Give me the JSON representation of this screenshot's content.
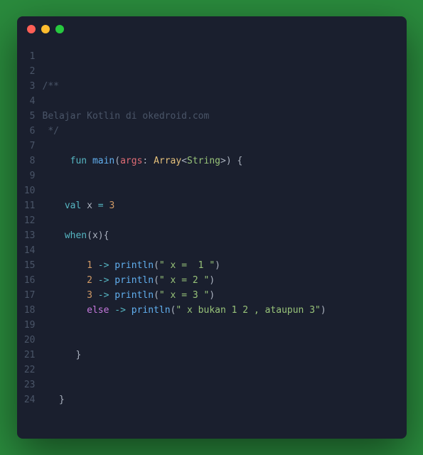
{
  "lines": [
    {
      "num": "1",
      "segments": []
    },
    {
      "num": "2",
      "segments": []
    },
    {
      "num": "3",
      "segments": [
        {
          "text": "/**",
          "cls": "comment"
        }
      ]
    },
    {
      "num": "4",
      "segments": []
    },
    {
      "num": "5",
      "segments": [
        {
          "text": "Belajar Kotlin di okedroid.com",
          "cls": "comment"
        }
      ]
    },
    {
      "num": "6",
      "segments": [
        {
          "text": " */",
          "cls": "comment"
        }
      ]
    },
    {
      "num": "7",
      "segments": []
    },
    {
      "num": "8",
      "segments": [
        {
          "text": "     ",
          "cls": ""
        },
        {
          "text": "fun",
          "cls": "keyword-blue"
        },
        {
          "text": " ",
          "cls": ""
        },
        {
          "text": "main",
          "cls": "funcname"
        },
        {
          "text": "(",
          "cls": "punct"
        },
        {
          "text": "args",
          "cls": "param"
        },
        {
          "text": ": ",
          "cls": "punct"
        },
        {
          "text": "Array",
          "cls": "type"
        },
        {
          "text": "<",
          "cls": "punct"
        },
        {
          "text": "String",
          "cls": "type-green"
        },
        {
          "text": ">",
          "cls": "punct"
        },
        {
          "text": ") {",
          "cls": "punct"
        }
      ]
    },
    {
      "num": "9",
      "segments": []
    },
    {
      "num": "10",
      "segments": []
    },
    {
      "num": "11",
      "segments": [
        {
          "text": "    ",
          "cls": ""
        },
        {
          "text": "val",
          "cls": "keyword-blue"
        },
        {
          "text": " ",
          "cls": ""
        },
        {
          "text": "x",
          "cls": "ident"
        },
        {
          "text": " ",
          "cls": ""
        },
        {
          "text": "=",
          "cls": "operator"
        },
        {
          "text": " ",
          "cls": ""
        },
        {
          "text": "3",
          "cls": "number"
        }
      ]
    },
    {
      "num": "12",
      "segments": []
    },
    {
      "num": "13",
      "segments": [
        {
          "text": "    ",
          "cls": ""
        },
        {
          "text": "when",
          "cls": "keyword-blue"
        },
        {
          "text": "(",
          "cls": "punct"
        },
        {
          "text": "x",
          "cls": "ident"
        },
        {
          "text": "){",
          "cls": "punct"
        }
      ]
    },
    {
      "num": "14",
      "segments": []
    },
    {
      "num": "15",
      "segments": [
        {
          "text": "        ",
          "cls": ""
        },
        {
          "text": "1",
          "cls": "number"
        },
        {
          "text": " ",
          "cls": ""
        },
        {
          "text": "->",
          "cls": "operator"
        },
        {
          "text": " ",
          "cls": ""
        },
        {
          "text": "println",
          "cls": "funcname"
        },
        {
          "text": "(",
          "cls": "punct"
        },
        {
          "text": "\" x =  1 \"",
          "cls": "string"
        },
        {
          "text": ")",
          "cls": "punct"
        }
      ]
    },
    {
      "num": "16",
      "segments": [
        {
          "text": "        ",
          "cls": ""
        },
        {
          "text": "2",
          "cls": "number"
        },
        {
          "text": " ",
          "cls": ""
        },
        {
          "text": "->",
          "cls": "operator"
        },
        {
          "text": " ",
          "cls": ""
        },
        {
          "text": "println",
          "cls": "funcname"
        },
        {
          "text": "(",
          "cls": "punct"
        },
        {
          "text": "\" x = 2 \"",
          "cls": "string"
        },
        {
          "text": ")",
          "cls": "punct"
        }
      ]
    },
    {
      "num": "17",
      "segments": [
        {
          "text": "        ",
          "cls": ""
        },
        {
          "text": "3",
          "cls": "number"
        },
        {
          "text": " ",
          "cls": ""
        },
        {
          "text": "->",
          "cls": "operator"
        },
        {
          "text": " ",
          "cls": ""
        },
        {
          "text": "println",
          "cls": "funcname"
        },
        {
          "text": "(",
          "cls": "punct"
        },
        {
          "text": "\" x = 3 \"",
          "cls": "string"
        },
        {
          "text": ")",
          "cls": "punct"
        }
      ]
    },
    {
      "num": "18",
      "segments": [
        {
          "text": "        ",
          "cls": ""
        },
        {
          "text": "else",
          "cls": "else-kw"
        },
        {
          "text": " ",
          "cls": ""
        },
        {
          "text": "->",
          "cls": "operator"
        },
        {
          "text": " ",
          "cls": ""
        },
        {
          "text": "println",
          "cls": "funcname"
        },
        {
          "text": "(",
          "cls": "punct"
        },
        {
          "text": "\" x bukan 1 2 , ataupun 3\"",
          "cls": "string"
        },
        {
          "text": ")",
          "cls": "punct"
        }
      ]
    },
    {
      "num": "19",
      "segments": []
    },
    {
      "num": "20",
      "segments": []
    },
    {
      "num": "21",
      "segments": [
        {
          "text": "      }",
          "cls": "punct"
        }
      ]
    },
    {
      "num": "22",
      "segments": []
    },
    {
      "num": "23",
      "segments": []
    },
    {
      "num": "24",
      "segments": [
        {
          "text": "   }",
          "cls": "punct"
        }
      ]
    }
  ]
}
